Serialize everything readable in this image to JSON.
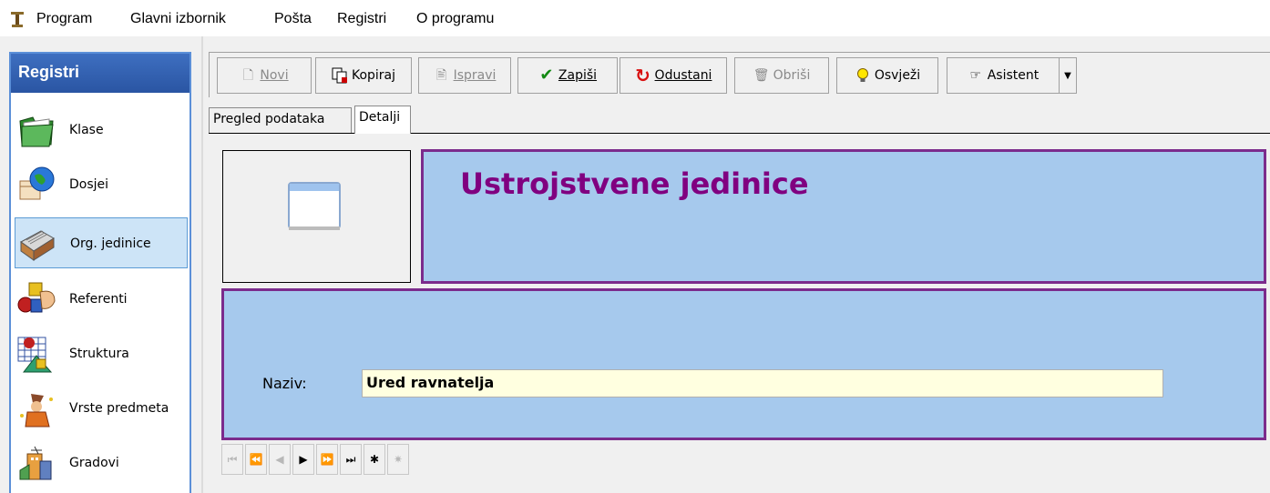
{
  "menu": {
    "items": [
      "Program",
      "Glavni izbornik",
      "Pošta",
      "Registri",
      "O programu"
    ]
  },
  "sidebar": {
    "title": "Registri",
    "items": [
      {
        "label": "Klase",
        "icon": "folder-icon"
      },
      {
        "label": "Dosjei",
        "icon": "globe-calendar-icon"
      },
      {
        "label": "Org. jedinice",
        "icon": "card-file-icon",
        "selected": true
      },
      {
        "label": "Referenti",
        "icon": "shapes-hand-icon"
      },
      {
        "label": "Struktura",
        "icon": "structure-icon"
      },
      {
        "label": "Vrste predmeta",
        "icon": "wizard-icon"
      },
      {
        "label": "Gradovi",
        "icon": "city-icon"
      }
    ]
  },
  "toolbar": {
    "novi": "Novi",
    "kopiraj": "Kopiraj",
    "ispravi": "Ispravi",
    "zapisi": "Zapiši",
    "odustani": "Odustani",
    "obrisi": "Obriši",
    "osvjezi": "Osvježi",
    "asistent": "Asistent"
  },
  "tabs": {
    "pregled": "Pregled podataka",
    "detalji": "Detalji"
  },
  "header": {
    "title": "Ustrojstvene jedinice"
  },
  "form": {
    "naziv_label": "Naziv:",
    "naziv_value": "Ured ravnatelja"
  },
  "colors": {
    "panel_bg": "#a6c9ed",
    "panel_border": "#7b2b8c",
    "title_color": "#800080",
    "input_bg": "#ffffe0"
  }
}
